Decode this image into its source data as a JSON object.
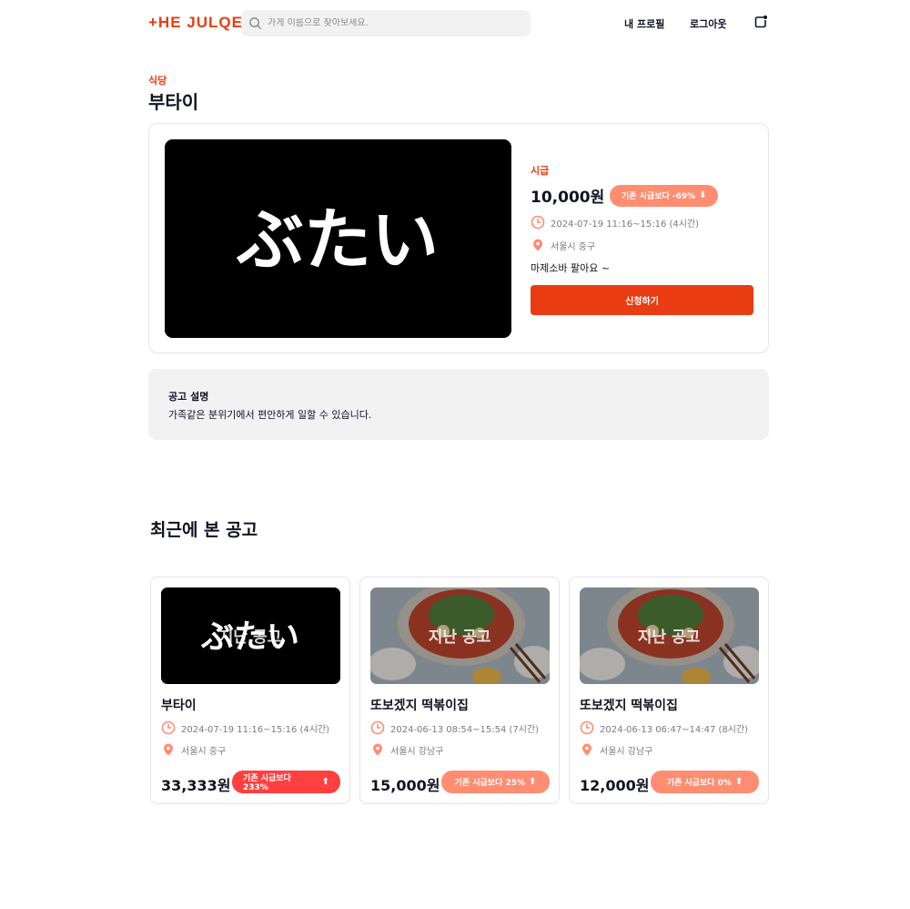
{
  "header": {
    "logo_text": "+HE JULQE",
    "search_placeholder": "가게 이름으로 찾아보세요.",
    "nav_profile": "내 프로필",
    "nav_logout": "로그아웃"
  },
  "shop": {
    "category": "식당",
    "name": "부타이",
    "image_logo_text": "ぶたい"
  },
  "notice": {
    "wage_label": "시급",
    "wage": "10,000원",
    "badge": "기존 시급보다 -69%",
    "time": "2024-07-19 11:16~15:16 (4시간)",
    "location": "서울시 중구",
    "short_desc": "마제소바 팔아요 ~",
    "apply_label": "신청하기"
  },
  "description": {
    "title": "공고 설명",
    "text": "가족같은 분위기에서 편안하게 일할 수 있습니다."
  },
  "recent": {
    "title": "최근에 본 공고",
    "overlay_label": "지난 공고",
    "cards": [
      {
        "name": "부타이",
        "time": "2024-07-19 11:16~15:16 (4시간)",
        "location": "서울시 중구",
        "wage": "33,333원",
        "badge": "기존 시급보다 233%"
      },
      {
        "name": "또보겠지 떡볶이집",
        "time": "2024-06-13 08:54~15:54 (7시간)",
        "location": "서울시 강남구",
        "wage": "15,000원",
        "badge": "기존 시급보다 25%"
      },
      {
        "name": "또보겠지 떡볶이집",
        "time": "2024-06-13 06:47~14:47 (8시간)",
        "location": "서울시 강남구",
        "wage": "12,000원",
        "badge": "기존 시급보다 0%"
      }
    ]
  },
  "colors": {
    "primary": "#EA3C12",
    "badge_salmon": "#FF8D72",
    "badge_red": "#FF4040",
    "text": "#111322",
    "muted": "#7D7986",
    "panel": "#F2F2F3",
    "border": "#E5E4E7"
  },
  "icons": {
    "search": "search-icon",
    "notification": "notification-icon",
    "clock": "clock-icon",
    "location": "location-pin-icon",
    "arrow_up": "arrow-up-icon"
  }
}
